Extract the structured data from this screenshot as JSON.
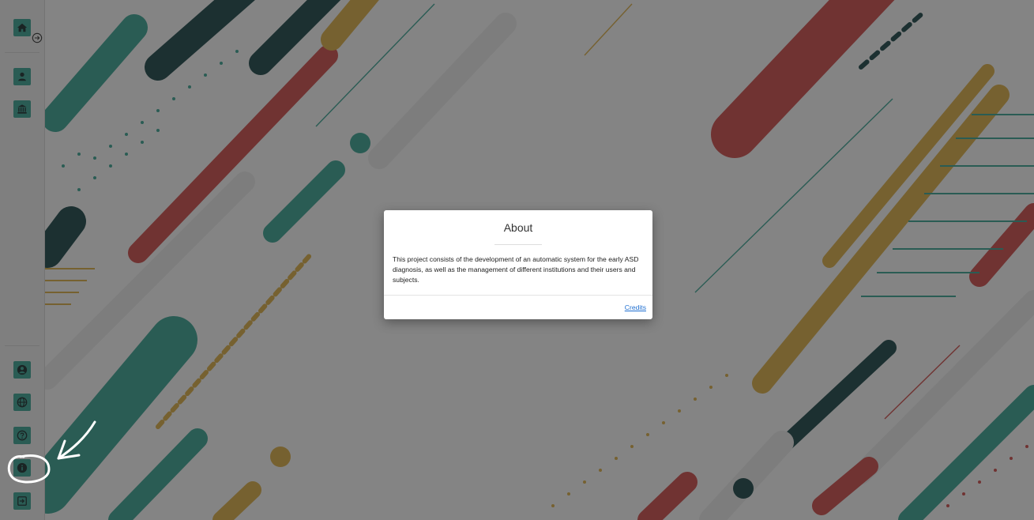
{
  "sidebar": {
    "top_items": [
      {
        "name": "home",
        "icon": "home-icon"
      },
      {
        "name": "user",
        "icon": "user-icon"
      },
      {
        "name": "institution",
        "icon": "institution-icon"
      }
    ],
    "expand_icon": "arrow-right-circle-icon",
    "bottom_items": [
      {
        "name": "account",
        "icon": "user-circle-icon"
      },
      {
        "name": "language",
        "icon": "globe-icon"
      },
      {
        "name": "help",
        "icon": "question-circle-icon"
      },
      {
        "name": "about",
        "icon": "info-circle-icon"
      },
      {
        "name": "logout",
        "icon": "sign-out-icon"
      }
    ]
  },
  "modal": {
    "title": "About",
    "body": "This project consists of the development of an automatic system for the early ASD diagnosis, as well as the management of different institutions and their users and subjects.",
    "credits_link": "Credits"
  },
  "colors": {
    "teal": "#2e9b8a",
    "dark_teal": "#0f3a3c",
    "red": "#c8403e",
    "mustard": "#d6a63a",
    "link": "#1f6fd1"
  }
}
